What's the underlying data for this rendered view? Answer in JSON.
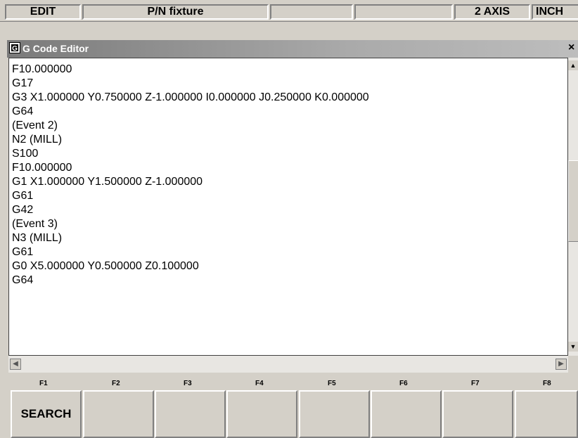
{
  "status_bar": {
    "mode": "EDIT",
    "part_name": "P/N fixture",
    "field_3": "",
    "field_4": "",
    "axis": "2 AXIS",
    "units": "INCH"
  },
  "window": {
    "icon_letter": "G",
    "title": "G Code Editor",
    "close": "×"
  },
  "code_lines": [
    "F10.000000",
    "G17",
    "G3 X1.000000 Y0.750000 Z-1.000000 I0.000000 J0.250000 K0.000000",
    "G64",
    "(Event 2)",
    "N2 (MILL)",
    "S100",
    "F10.000000",
    "G1 X1.000000 Y1.500000 Z-1.000000",
    "G61",
    "G42",
    "(Event 3)",
    "N3 (MILL)",
    "G61",
    "G0 X5.000000 Y0.500000 Z0.100000",
    "G64"
  ],
  "scrollbars": {
    "up": "▲",
    "down": "▼",
    "left": "◀",
    "right": "▶"
  },
  "function_keys": [
    {
      "key": "F1",
      "label": "SEARCH"
    },
    {
      "key": "F2",
      "label": ""
    },
    {
      "key": "F3",
      "label": ""
    },
    {
      "key": "F4",
      "label": ""
    },
    {
      "key": "F5",
      "label": ""
    },
    {
      "key": "F6",
      "label": ""
    },
    {
      "key": "F7",
      "label": ""
    },
    {
      "key": "F8",
      "label": ""
    }
  ]
}
